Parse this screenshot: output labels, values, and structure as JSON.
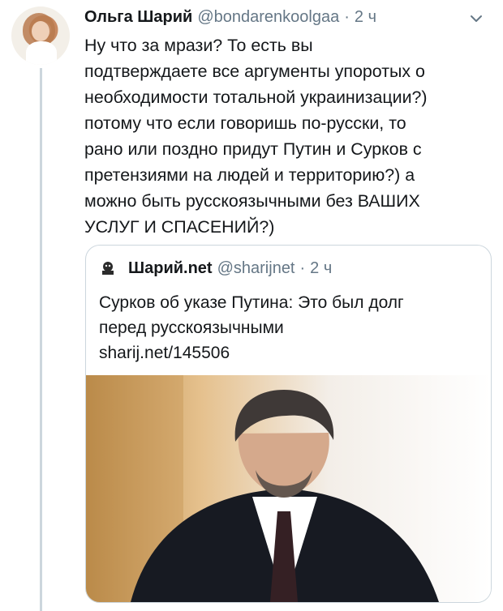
{
  "tweet": {
    "author_name": "Ольга Шарий",
    "author_handle": "@bondarenkoolgaa",
    "separator": "·",
    "time": "2 ч",
    "text": "Ну что за мрази? То есть вы\nподтверждаете все аргументы упоротых о\nнеобходимости тотальной украинизации?)\nпотому что если говоришь по-русски, то\nрано или поздно придут Путин и Сурков с\nпретензиями на людей и территорию?) а\nможно быть русскоязычными без ВАШИХ\nУСЛУГ И СПАСЕНИЙ?)"
  },
  "quoted_tweet": {
    "author_name": "Шарий.net",
    "author_handle": "@sharijnet",
    "separator": "·",
    "time": "2 ч",
    "text": "Сурков об указе Путина: Это был долг\nперед русскоязычными\nsharij.net/145506"
  },
  "icons": {
    "menu": "chevron-down-icon",
    "quoted_avatar": "sharij-logo-icon"
  },
  "colors": {
    "primary_text": "#14171a",
    "secondary_text": "#657786",
    "border": "#ccd6dd"
  }
}
